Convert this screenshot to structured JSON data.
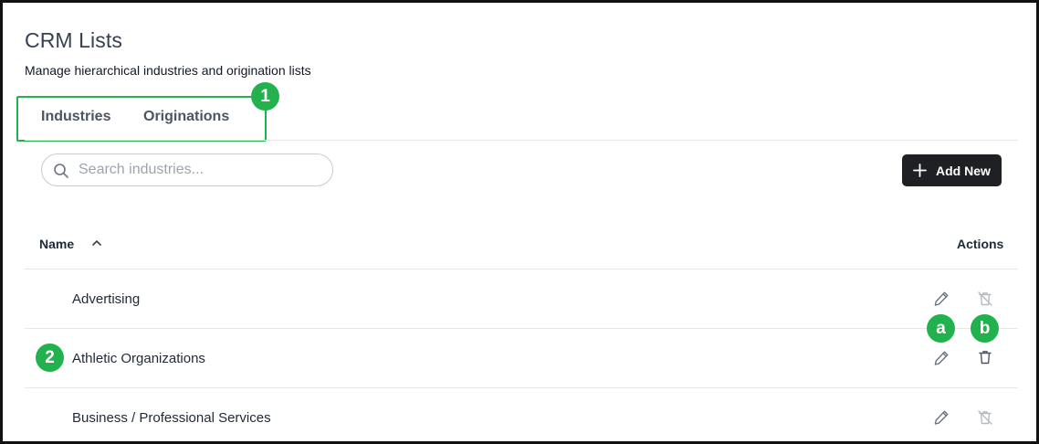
{
  "header": {
    "title": "CRM Lists",
    "subtitle": "Manage hierarchical industries and origination lists"
  },
  "tabs": [
    {
      "label": "Industries",
      "active": true
    },
    {
      "label": "Originations",
      "active": false
    }
  ],
  "search": {
    "placeholder": "Search industries...",
    "value": ""
  },
  "toolbar": {
    "add_label": "Add New"
  },
  "table": {
    "columns": [
      "Name",
      "Actions"
    ],
    "sort": "ascending",
    "rows": [
      {
        "name": "Advertising",
        "delete_enabled": false
      },
      {
        "name": "Athletic Organizations",
        "delete_enabled": true
      },
      {
        "name": "Business / Professional Services",
        "delete_enabled": false
      }
    ]
  },
  "annotations": {
    "badge_1": "1",
    "badge_2": "2",
    "badge_a": "a",
    "badge_b": "b"
  },
  "colors": {
    "annotation_green": "#22b14c",
    "button_dark": "#1f2023",
    "icon_gray": "#6b7280",
    "icon_disabled": "#b6bbc2"
  },
  "icons": {
    "search": "search-icon",
    "add": "plus-icon",
    "sort": "chevron-up-icon",
    "edit": "pencil-icon",
    "delete": "trash-icon",
    "delete_disabled": "trash-disabled-icon"
  }
}
